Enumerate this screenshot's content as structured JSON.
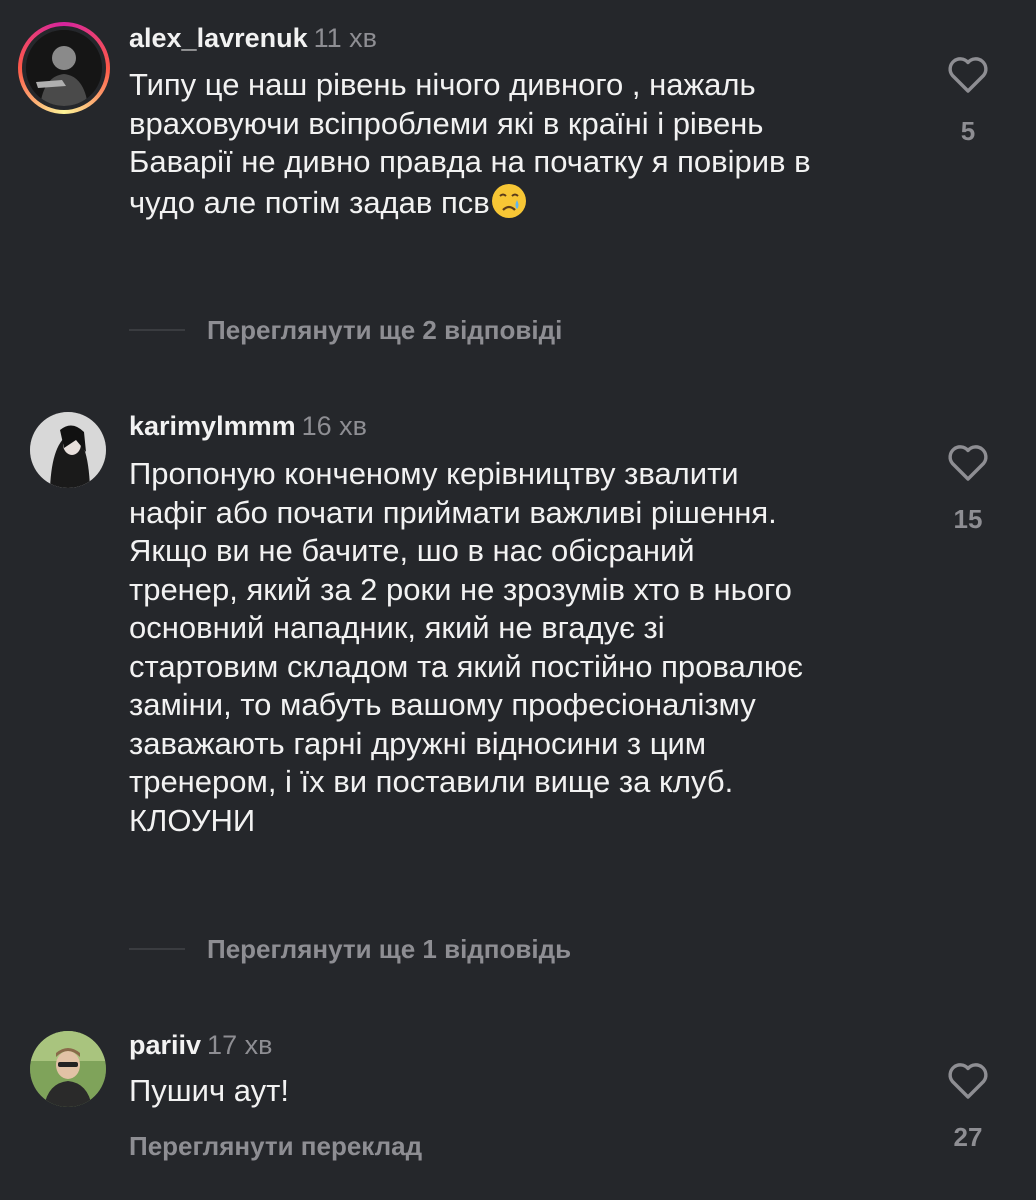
{
  "comments": [
    {
      "username": "alex_lavrenuk",
      "time": "11 хв",
      "text": "Типу це наш рівень нічого дивного , нажаль\nвраховуючи всіпроблеми які в країні і рівень\nБаварії не дивно правда на початку я повірив в\nчудо але потім задав псв",
      "emoji": "crying-face",
      "likes": "5",
      "replies_label": "Переглянути ще 2 відповіді"
    },
    {
      "username": "karimylmmm",
      "time": "16 хв",
      "text": "Пропоную конченому керівництву звалити\nнафіг або почати приймати важливі рішення.\nЯкщо ви не бачите, шо в нас обісраний\nтренер, який за 2 роки не зрозумів хто в нього\nосновний нападник, який не вгадує зі\nстартовим складом та який постійно провалює\nзаміни, то мабуть вашому професіоналізму\nзаважають гарні дружні відносини з цим\nтренером, і їх ви поставили вище за клуб.\nКЛОУНИ",
      "likes": "15",
      "replies_label": "Переглянути ще 1 відповідь"
    },
    {
      "username": "pariiv",
      "time": "17 хв",
      "text": "Пушич аут!",
      "likes": "27",
      "translate_label": "Переглянути переклад"
    }
  ],
  "icons": {
    "like": "heart-outline-icon"
  },
  "colors": {
    "background": "#25272b",
    "secondary_text": "#8e8e93",
    "primary_text": "#f2f2f2"
  }
}
